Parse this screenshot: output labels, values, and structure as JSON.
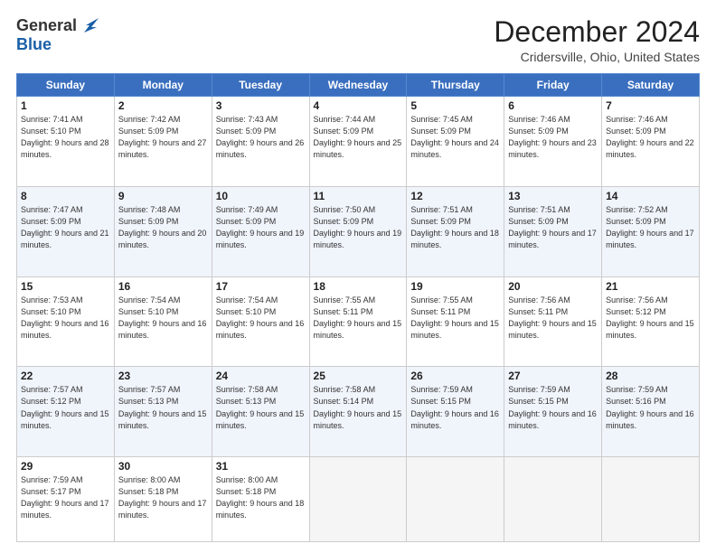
{
  "header": {
    "logo_general": "General",
    "logo_blue": "Blue",
    "month_title": "December 2024",
    "location": "Cridersville, Ohio, United States"
  },
  "days_of_week": [
    "Sunday",
    "Monday",
    "Tuesday",
    "Wednesday",
    "Thursday",
    "Friday",
    "Saturday"
  ],
  "weeks": [
    [
      {
        "day": 1,
        "sunrise": "7:41 AM",
        "sunset": "5:10 PM",
        "daylight": "9 hours and 28 minutes."
      },
      {
        "day": 2,
        "sunrise": "7:42 AM",
        "sunset": "5:09 PM",
        "daylight": "9 hours and 27 minutes."
      },
      {
        "day": 3,
        "sunrise": "7:43 AM",
        "sunset": "5:09 PM",
        "daylight": "9 hours and 26 minutes."
      },
      {
        "day": 4,
        "sunrise": "7:44 AM",
        "sunset": "5:09 PM",
        "daylight": "9 hours and 25 minutes."
      },
      {
        "day": 5,
        "sunrise": "7:45 AM",
        "sunset": "5:09 PM",
        "daylight": "9 hours and 24 minutes."
      },
      {
        "day": 6,
        "sunrise": "7:46 AM",
        "sunset": "5:09 PM",
        "daylight": "9 hours and 23 minutes."
      },
      {
        "day": 7,
        "sunrise": "7:46 AM",
        "sunset": "5:09 PM",
        "daylight": "9 hours and 22 minutes."
      }
    ],
    [
      {
        "day": 8,
        "sunrise": "7:47 AM",
        "sunset": "5:09 PM",
        "daylight": "9 hours and 21 minutes."
      },
      {
        "day": 9,
        "sunrise": "7:48 AM",
        "sunset": "5:09 PM",
        "daylight": "9 hours and 20 minutes."
      },
      {
        "day": 10,
        "sunrise": "7:49 AM",
        "sunset": "5:09 PM",
        "daylight": "9 hours and 19 minutes."
      },
      {
        "day": 11,
        "sunrise": "7:50 AM",
        "sunset": "5:09 PM",
        "daylight": "9 hours and 19 minutes."
      },
      {
        "day": 12,
        "sunrise": "7:51 AM",
        "sunset": "5:09 PM",
        "daylight": "9 hours and 18 minutes."
      },
      {
        "day": 13,
        "sunrise": "7:51 AM",
        "sunset": "5:09 PM",
        "daylight": "9 hours and 17 minutes."
      },
      {
        "day": 14,
        "sunrise": "7:52 AM",
        "sunset": "5:09 PM",
        "daylight": "9 hours and 17 minutes."
      }
    ],
    [
      {
        "day": 15,
        "sunrise": "7:53 AM",
        "sunset": "5:10 PM",
        "daylight": "9 hours and 16 minutes."
      },
      {
        "day": 16,
        "sunrise": "7:54 AM",
        "sunset": "5:10 PM",
        "daylight": "9 hours and 16 minutes."
      },
      {
        "day": 17,
        "sunrise": "7:54 AM",
        "sunset": "5:10 PM",
        "daylight": "9 hours and 16 minutes."
      },
      {
        "day": 18,
        "sunrise": "7:55 AM",
        "sunset": "5:11 PM",
        "daylight": "9 hours and 15 minutes."
      },
      {
        "day": 19,
        "sunrise": "7:55 AM",
        "sunset": "5:11 PM",
        "daylight": "9 hours and 15 minutes."
      },
      {
        "day": 20,
        "sunrise": "7:56 AM",
        "sunset": "5:11 PM",
        "daylight": "9 hours and 15 minutes."
      },
      {
        "day": 21,
        "sunrise": "7:56 AM",
        "sunset": "5:12 PM",
        "daylight": "9 hours and 15 minutes."
      }
    ],
    [
      {
        "day": 22,
        "sunrise": "7:57 AM",
        "sunset": "5:12 PM",
        "daylight": "9 hours and 15 minutes."
      },
      {
        "day": 23,
        "sunrise": "7:57 AM",
        "sunset": "5:13 PM",
        "daylight": "9 hours and 15 minutes."
      },
      {
        "day": 24,
        "sunrise": "7:58 AM",
        "sunset": "5:13 PM",
        "daylight": "9 hours and 15 minutes."
      },
      {
        "day": 25,
        "sunrise": "7:58 AM",
        "sunset": "5:14 PM",
        "daylight": "9 hours and 15 minutes."
      },
      {
        "day": 26,
        "sunrise": "7:59 AM",
        "sunset": "5:15 PM",
        "daylight": "9 hours and 16 minutes."
      },
      {
        "day": 27,
        "sunrise": "7:59 AM",
        "sunset": "5:15 PM",
        "daylight": "9 hours and 16 minutes."
      },
      {
        "day": 28,
        "sunrise": "7:59 AM",
        "sunset": "5:16 PM",
        "daylight": "9 hours and 16 minutes."
      }
    ],
    [
      {
        "day": 29,
        "sunrise": "7:59 AM",
        "sunset": "5:17 PM",
        "daylight": "9 hours and 17 minutes."
      },
      {
        "day": 30,
        "sunrise": "8:00 AM",
        "sunset": "5:18 PM",
        "daylight": "9 hours and 17 minutes."
      },
      {
        "day": 31,
        "sunrise": "8:00 AM",
        "sunset": "5:18 PM",
        "daylight": "9 hours and 18 minutes."
      },
      null,
      null,
      null,
      null
    ]
  ]
}
